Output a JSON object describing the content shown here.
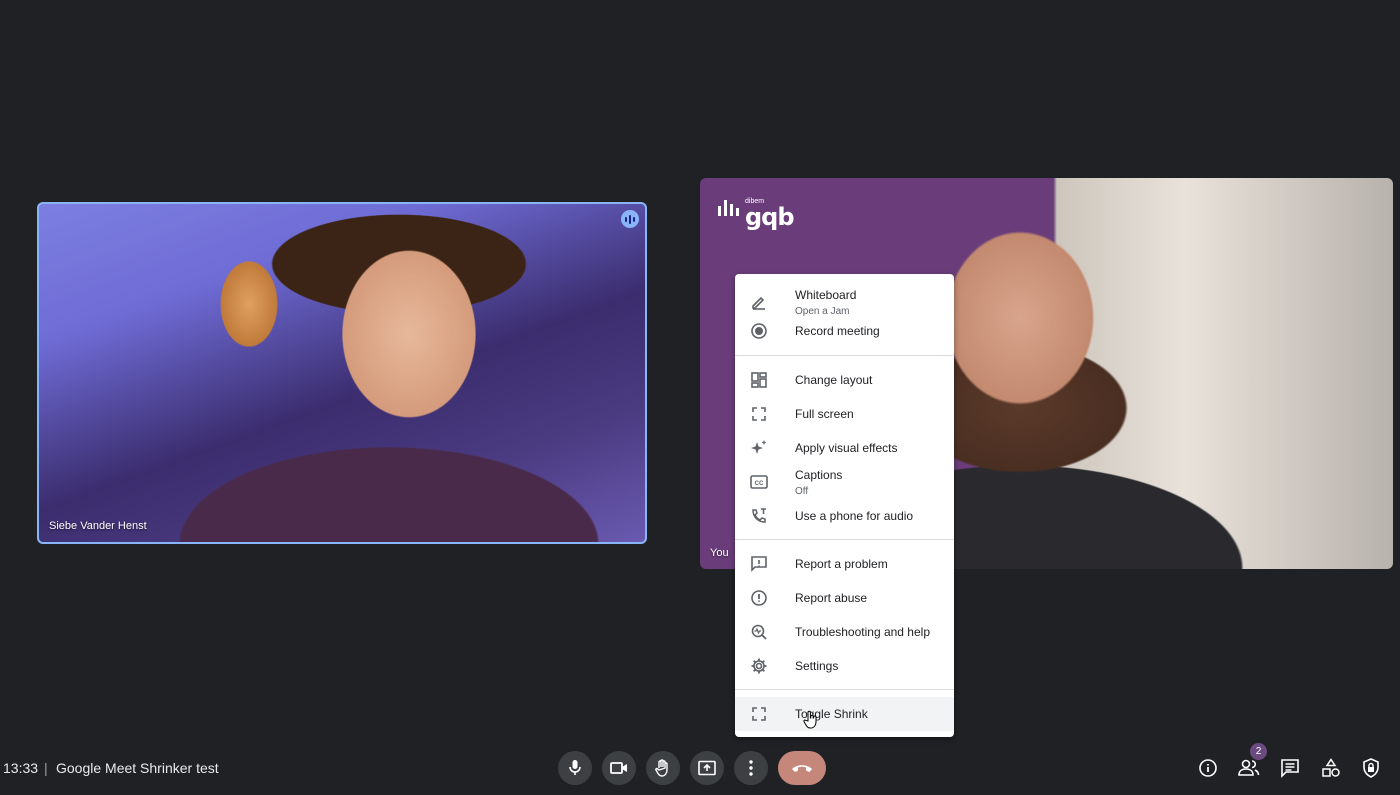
{
  "participants": {
    "remote_name": "Siebe Vander Henst",
    "self_name": "You",
    "self_logo": {
      "small": "dibem",
      "big": "gqb"
    }
  },
  "menu": {
    "whiteboard": {
      "label": "Whiteboard",
      "sub": "Open a Jam"
    },
    "record": "Record meeting",
    "change_layout": "Change layout",
    "full_screen": "Full screen",
    "visual_effects": "Apply visual effects",
    "captions": {
      "label": "Captions",
      "sub": "Off"
    },
    "phone_audio": "Use a phone for audio",
    "report_problem": "Report a problem",
    "report_abuse": "Report abuse",
    "troubleshooting": "Troubleshooting and help",
    "settings": "Settings",
    "toggle_shrink": "Toggle Shrink"
  },
  "bottom_bar": {
    "time": "13:33",
    "divider": "|",
    "meeting_title": "Google Meet Shrinker test",
    "people_count": "2"
  },
  "colors": {
    "background": "#202124",
    "end_call": "#c5877a",
    "speaking_border": "#8ab4f8",
    "badge": "#6b4a80"
  }
}
